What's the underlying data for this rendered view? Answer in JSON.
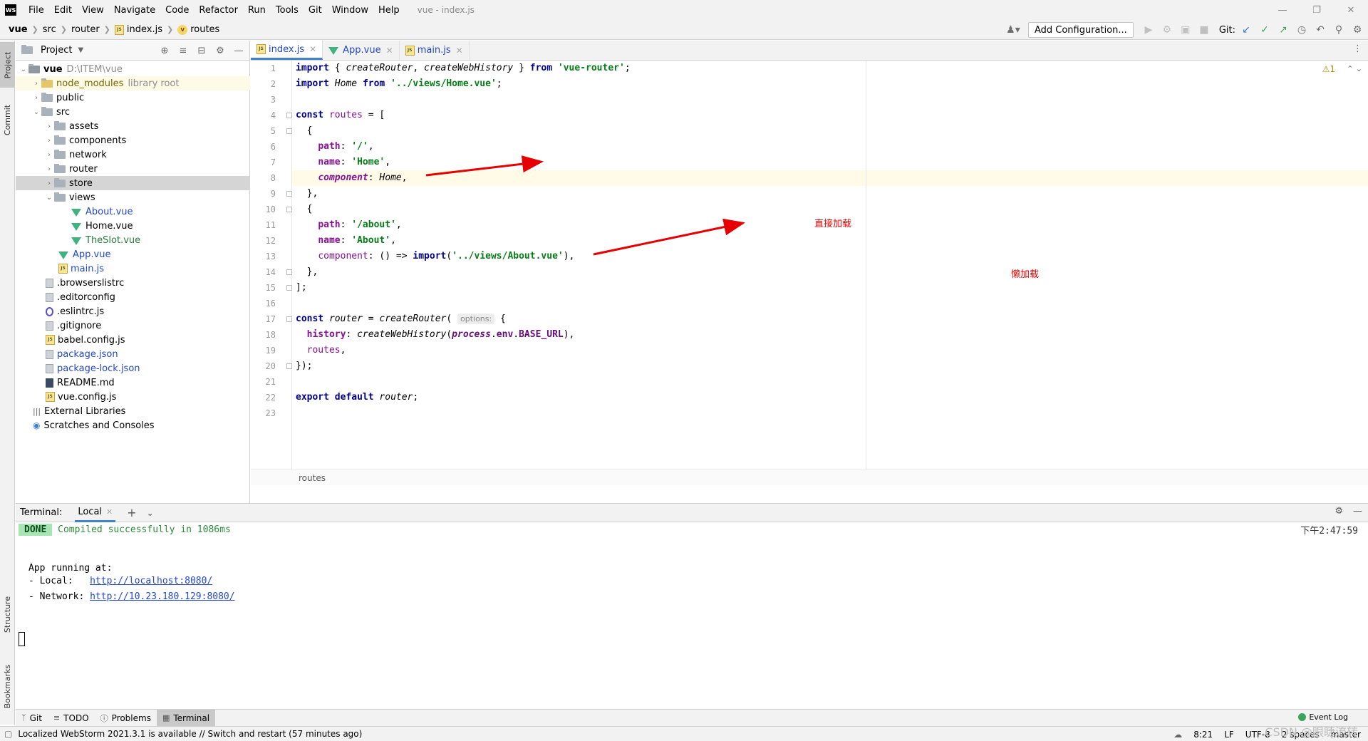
{
  "window": {
    "title": "vue - index.js",
    "logo": "WS"
  },
  "menu": [
    "File",
    "Edit",
    "View",
    "Navigate",
    "Code",
    "Refactor",
    "Run",
    "Tools",
    "Git",
    "Window",
    "Help"
  ],
  "breadcrumb": {
    "items": [
      "vue",
      "src",
      "router",
      "index.js",
      "routes"
    ]
  },
  "toolbar": {
    "add_config": "Add Configuration...",
    "git_label": "Git:"
  },
  "project": {
    "title": "Project",
    "tree": [
      {
        "label": "vue",
        "extra": "D:\\ITEM\\vue",
        "bold": true
      },
      {
        "label": "node_modules",
        "extra": "library root"
      },
      {
        "label": "public"
      },
      {
        "label": "src"
      },
      {
        "label": "assets"
      },
      {
        "label": "components"
      },
      {
        "label": "network"
      },
      {
        "label": "router"
      },
      {
        "label": "store"
      },
      {
        "label": "views"
      },
      {
        "label": "About.vue"
      },
      {
        "label": "Home.vue"
      },
      {
        "label": "TheSlot.vue"
      },
      {
        "label": "App.vue"
      },
      {
        "label": "main.js"
      },
      {
        "label": ".browserslistrc"
      },
      {
        "label": ".editorconfig"
      },
      {
        "label": ".eslintrc.js"
      },
      {
        "label": ".gitignore"
      },
      {
        "label": "babel.config.js"
      },
      {
        "label": "package.json"
      },
      {
        "label": "package-lock.json"
      },
      {
        "label": "README.md"
      },
      {
        "label": "vue.config.js"
      },
      {
        "label": "External Libraries"
      },
      {
        "label": "Scratches and Consoles"
      }
    ]
  },
  "editor": {
    "tabs": [
      "index.js",
      "App.vue",
      "main.js"
    ],
    "line_numbers": [
      "1",
      "2",
      "3",
      "4",
      "5",
      "6",
      "7",
      "8",
      "9",
      "10",
      "11",
      "12",
      "13",
      "14",
      "15",
      "16",
      "17",
      "18",
      "19",
      "20",
      "21",
      "22",
      "23"
    ],
    "code": {
      "l1": {
        "kw": "import",
        "a": " { ",
        "b": "createRouter",
        "c": ", ",
        "d": "createWebHistory",
        "e": " } ",
        "kw2": "from",
        "sp": " ",
        "str": "'vue-router'",
        "end": ";"
      },
      "l2": {
        "kw": "import",
        "sp": " ",
        "name": "Home",
        "sp2": " ",
        "kw2": "from",
        "sp3": " ",
        "str": "'../views/Home.vue'",
        "end": ";"
      },
      "l4": {
        "kw": "const",
        "sp": " ",
        "name": "routes",
        "end": " = ["
      },
      "l5": "  {",
      "l6": {
        "ind": "    ",
        "prop": "path",
        "c": ": ",
        "str": "'/'",
        "end": ","
      },
      "l7": {
        "ind": "    ",
        "prop": "name",
        "c": ": ",
        "str": "'Home'",
        "end": ","
      },
      "l8": {
        "ind": "    ",
        "prop": "component",
        "c": ": ",
        "val": "Home",
        "end": ","
      },
      "l9": "  },",
      "l10": "  {",
      "l11": {
        "ind": "    ",
        "prop": "path",
        "c": ": ",
        "str": "'/about'",
        "end": ","
      },
      "l12": {
        "ind": "    ",
        "prop": "name",
        "c": ": ",
        "str": "'About'",
        "end": ","
      },
      "l13": {
        "ind": "    ",
        "prop": "component",
        "c": ": () => ",
        "kw": "import",
        "p": "(",
        "str": "'../views/About.vue'",
        "end": "),"
      },
      "l14": "  },",
      "l15": "];",
      "l17": {
        "kw": "const",
        "sp": " ",
        "name": "router",
        "eq": " = ",
        "fn": "createRouter",
        "p": "( ",
        "hint": "options:",
        "end": " {"
      },
      "l18": {
        "ind": "  ",
        "prop": "history",
        "c": ": ",
        "fn": "createWebHistory",
        "p": "(",
        "a": "process",
        "d1": ".",
        "b": "env",
        "d2": ".",
        "c2": "BASE_URL",
        "end": "),"
      },
      "l19": {
        "ind": "  ",
        "prop": "routes",
        "end": ","
      },
      "l20": "});",
      "l22": {
        "kw": "export",
        "sp": " ",
        "kw2": "default",
        "sp2": " ",
        "name": "router",
        "end": ";"
      }
    },
    "bottom_breadcrumb": "routes",
    "warnings": "⚠1",
    "annotations": {
      "direct": "直接加载",
      "lazy": "懒加载"
    }
  },
  "terminal": {
    "label": "Terminal:",
    "tab": "Local",
    "done": "DONE",
    "compiled": "Compiled successfully in 1086ms",
    "time": "下午2:47:59",
    "running": "App running at:",
    "local_label": "- Local:   ",
    "local_url": "http://localhost:8080/",
    "network_label": "- Network: ",
    "network_url": "http://10.23.180.129:8080/"
  },
  "tool_tabs": [
    "Git",
    "TODO",
    "Problems",
    "Terminal"
  ],
  "event_log": "Event Log",
  "status": {
    "message": "Localized WebStorm 2021.3.1 is available // Switch and restart (57 minutes ago)",
    "position": "8:21",
    "line_sep": "LF",
    "encoding": "UTF-8",
    "indent": "2 spaces",
    "branch": "master"
  },
  "side_tabs": {
    "project": "Project",
    "commit": "Commit",
    "structure": "Structure",
    "bookmarks": "Bookmarks"
  },
  "watermark": "CSDN @眼睫流转",
  "colors": {
    "accent": "#4083c9",
    "annotation": "#e60000",
    "keyword": "#00008b",
    "string": "#067d17"
  }
}
